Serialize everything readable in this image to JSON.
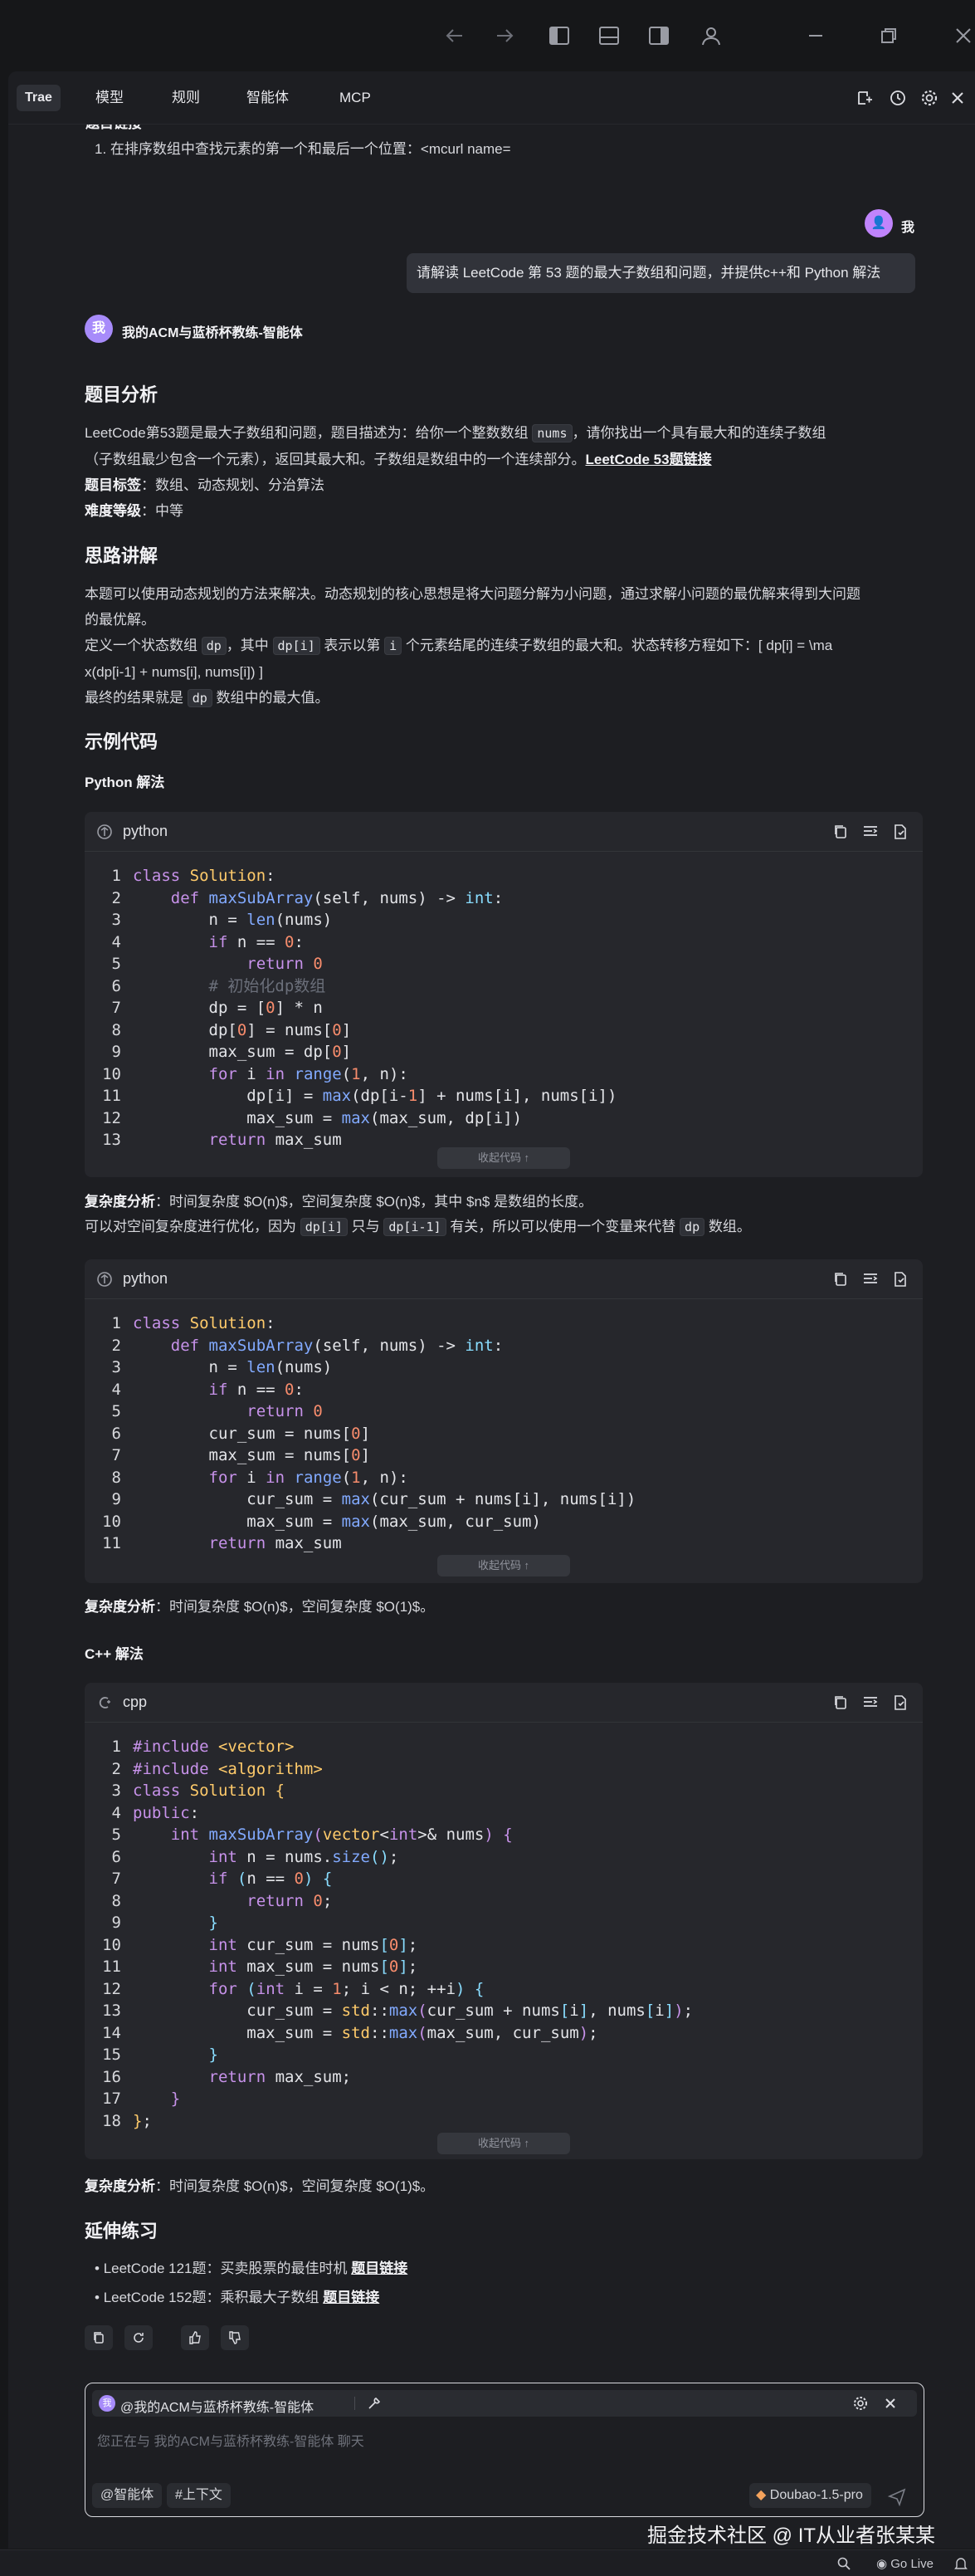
{
  "tabs": [
    "Trae",
    "模型",
    "规则",
    "智能体",
    "MCP"
  ],
  "cut_heading": "题目链接",
  "cut_list_item": "1. 在排序数组中查找元素的第一个和最后一个位置：<mcurl name=",
  "user": {
    "avatar": "👤",
    "name": "我",
    "message": "请解读 LeetCode 第 53 题的最大子数组和问题，并提供c++和 Python 解法"
  },
  "agent": {
    "avatar": "我",
    "name": "我的ACM与蓝桥杯教练-智能体"
  },
  "analysis": {
    "heading": "题目分析",
    "p1a": "LeetCode第53题是最大子数组和问题，题目描述为：给你一个整数数组",
    "p1_code": "nums",
    "p1b": "，请你找出一个具有最大和的连续子数组",
    "p1c": "（子数组最少包含一个元素），返回其最大和。子数组是数组中的一个连续部分。",
    "p1_link": "LeetCode 53题链接",
    "tags_label": "题目标签",
    "tags_value": "：数组、动态规划、分治算法",
    "difficulty_label": "难度等级",
    "difficulty_value": "：中等"
  },
  "thinking": {
    "heading": "思路讲解",
    "p1": "本题可以使用动态规划的方法来解决。动态规划的核心思想是将大问题分解为小问题，通过求解小问题的最优解来得到大问题",
    "p1b": "的最优解。",
    "p2a": "定义一个状态数组",
    "p2_code1": "dp",
    "p2b": "，其中",
    "p2_code2": "dp[i]",
    "p2c": "表示以第",
    "p2_code3": "i",
    "p2d": "个元素结尾的连续子数组的最大和。状态转移方程如下：[ dp[i] = \\ma",
    "p2e": "x(dp[i-1] + nums[i], nums[i]) ]",
    "p3a": "最终的结果就是",
    "p3_code": "dp",
    "p3b": "数组中的最大值。"
  },
  "examples": {
    "heading": "示例代码",
    "python_heading": "Python 解法",
    "cpp_heading": "C++ 解法",
    "collapse_label": "收起代码 ↑",
    "py1_lang": "python",
    "py2_lang": "python",
    "cpp_lang": "cpp"
  },
  "complexity1": {
    "label": "复杂度分析",
    "value": "：时间复杂度 $O(n)$，空间复杂度 $O(n)$，其中 $n$ 是数组的长度。"
  },
  "optimize": {
    "a": "可以对空间复杂度进行优化，因为",
    "code1": "dp[i]",
    "b": "只与",
    "code2": "dp[i-1]",
    "c": "有关，所以可以使用一个变量来代替",
    "code3": "dp",
    "d": "数组。"
  },
  "complexity2": {
    "label": "复杂度分析",
    "value": "：时间复杂度 $O(n)$，空间复杂度 $O(1)$。"
  },
  "complexity3": {
    "label": "复杂度分析",
    "value": "：时间复杂度 $O(n)$，空间复杂度 $O(1)$。"
  },
  "extension": {
    "heading": "延伸练习",
    "items": [
      {
        "text": "LeetCode 121题：买卖股票的最佳时机",
        "link": "题目链接"
      },
      {
        "text": "LeetCode 152题：乘积最大子数组",
        "link": "题目链接"
      }
    ]
  },
  "input": {
    "agent_tag": "@我的ACM与蓝桥杯教练-智能体",
    "placeholder": "您正在与 我的ACM与蓝桥杯教练-智能体 聊天",
    "btn_agent": "@智能体",
    "btn_context": "#上下文",
    "model": "Doubao-1.5-pro"
  },
  "watermark": "掘金技术社区 @ IT从业者张某某",
  "status": {
    "golive": "Go Live"
  }
}
